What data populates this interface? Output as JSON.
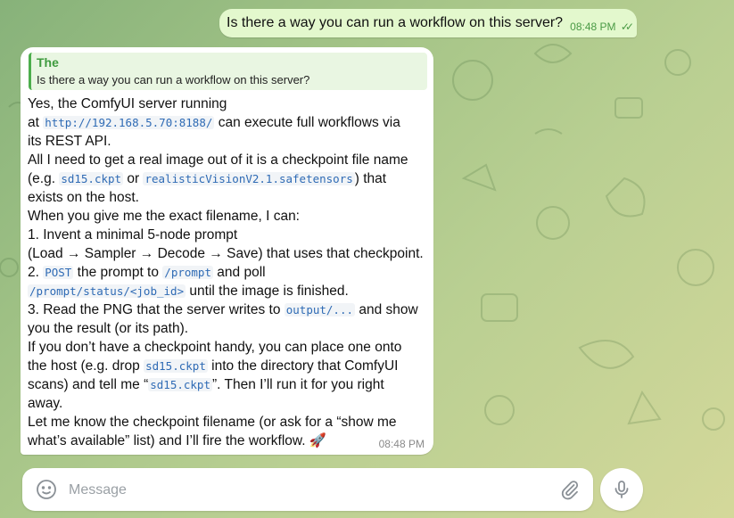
{
  "outgoing": {
    "text": "Is there a way you can run a workflow on this server?",
    "time": "08:48 PM",
    "status_icon": "double-check-icon"
  },
  "incoming": {
    "reply_name": "The",
    "reply_text": "Is there a way you can run a workflow on this server?",
    "time": "08:48 PM",
    "lines": [
      {
        "text": "Yes, the ComfyUI server running"
      },
      {
        "a": "at ",
        "code": "http://192.168.5.70:8188/",
        "b": " can execute full workflows via"
      },
      {
        "text": "its REST API."
      },
      {
        "text": "All I need to get a real image out of it is a checkpoint file name"
      },
      {
        "a": "(e.g. ",
        "code": "sd15.ckpt",
        "b": " or ",
        "code2": "realisticVisionV2.1.safetensors",
        "c": ") that"
      },
      {
        "text": "exists on the host."
      },
      {
        "text": "When you give me the exact filename, I can:"
      },
      {
        "text": "1. Invent a minimal 5-node prompt"
      },
      {
        "text": "(Load → Sampler → Decode → Save) that uses that checkpoint."
      },
      {
        "a": "2. ",
        "code": "POST",
        "b": " the prompt to ",
        "code2": "/prompt",
        "c": " and poll"
      },
      {
        "code": "/prompt/status/<job_id>",
        "b": " until the image is finished."
      },
      {
        "a": "3. Read the PNG that the server writes to ",
        "code": "output/...",
        "b": " and show"
      },
      {
        "text": "you the result (or its path)."
      },
      {
        "text": "If you don’t have a checkpoint handy, you can place one onto"
      },
      {
        "a": "the host (e.g. drop ",
        "code": "sd15.ckpt",
        "b": " into the directory that ComfyUI"
      },
      {
        "a": "scans) and tell me “",
        "code": "sd15.ckpt",
        "b": "”. Then I’ll run it for you right"
      },
      {
        "text": "away."
      },
      {
        "text": "Let me know the checkpoint filename (or ask for a “show me"
      },
      {
        "text": "what’s available” list) and I’ll fire the workflow. 🚀"
      }
    ]
  },
  "composer": {
    "placeholder": "Message",
    "emoji_icon": "smile-icon",
    "attach_icon": "paperclip-icon",
    "mic_icon": "microphone-icon"
  }
}
